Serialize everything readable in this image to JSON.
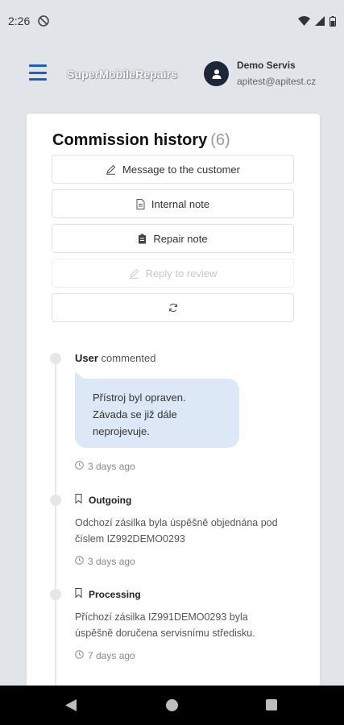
{
  "status_bar": {
    "time": "2:26"
  },
  "header": {
    "brand": "SuperMobileRepairs",
    "user_name": "Demo Servis",
    "user_email": "apitest@apitest.cz"
  },
  "history": {
    "title": "Commission history",
    "count": "(6)",
    "buttons": {
      "message": "Message to the customer",
      "internal": "Internal note",
      "repair": "Repair note",
      "review": "Reply to review"
    }
  },
  "timeline": {
    "comment": {
      "author": "User",
      "verb": "commented",
      "text_line1": "Přístroj byl opraven.",
      "text_line2": "Závada se již dále",
      "text_line3": "neprojevuje.",
      "time": "3 days ago"
    },
    "outgoing": {
      "title": "Outgoing",
      "text_line1": "Odchozí zásilka byla úspěšně objednána pod",
      "text_line2": "číslem IZ992DEMO0293",
      "time": "3 days ago"
    },
    "processing": {
      "title": "Processing",
      "text_line1": "Příchozí zásilka IZ991DEMO0293 byla",
      "text_line2": "úspěšně doručena servisnímu středisku.",
      "time": "7 days ago"
    }
  },
  "colors": {
    "accent": "#1f5fbf",
    "bubble": "#dce8f6",
    "avatar": "#1d2637"
  },
  "icons": {
    "status": [
      "do-not-disturb-icon",
      "wifi-icon",
      "signal-icon",
      "battery-icon"
    ],
    "nav": [
      "back-icon",
      "home-icon",
      "recents-icon"
    ]
  }
}
